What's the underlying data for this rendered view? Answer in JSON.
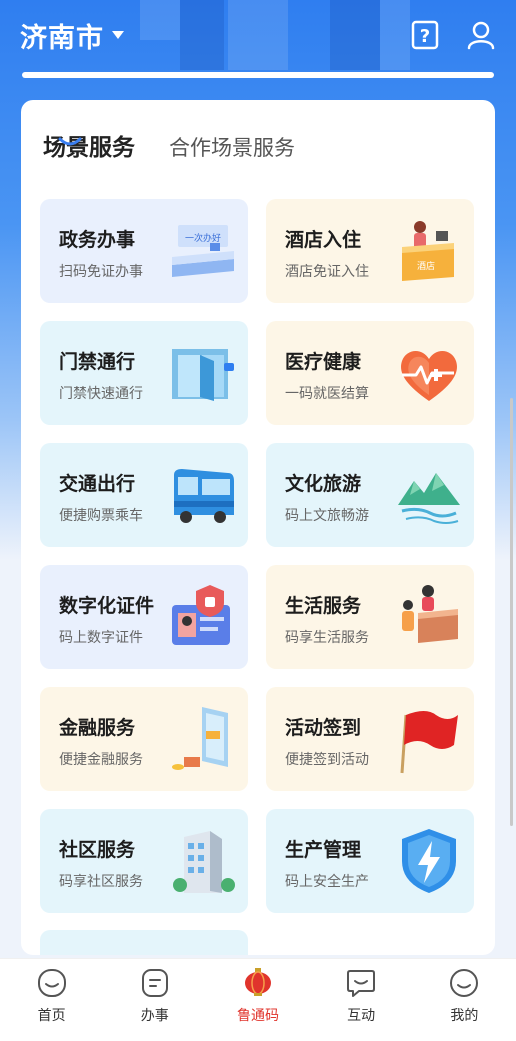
{
  "header": {
    "city": "济南市",
    "icons": [
      "help-icon",
      "user-icon"
    ]
  },
  "tabs": [
    {
      "label": "场景服务",
      "active": true
    },
    {
      "label": "合作场景服务",
      "active": false
    }
  ],
  "cards": [
    {
      "title": "政务办事",
      "subtitle": "扫码免证办事",
      "icon": "service-counter-icon",
      "tone": "blue",
      "art_text": "一次办好"
    },
    {
      "title": "酒店入住",
      "subtitle": "酒店免证入住",
      "icon": "hotel-reception-icon",
      "tone": "cream",
      "art_text": "酒店"
    },
    {
      "title": "门禁通行",
      "subtitle": "门禁快速通行",
      "icon": "door-access-icon",
      "tone": "cyan"
    },
    {
      "title": "医疗健康",
      "subtitle": "一码就医结算",
      "icon": "heart-health-icon",
      "tone": "cream"
    },
    {
      "title": "交通出行",
      "subtitle": "便捷购票乘车",
      "icon": "bus-icon",
      "tone": "cyan"
    },
    {
      "title": "文化旅游",
      "subtitle": "码上文旅畅游",
      "icon": "mountain-icon",
      "tone": "cyan"
    },
    {
      "title": "数字化证件",
      "subtitle": "码上数字证件",
      "icon": "id-card-icon",
      "tone": "blue"
    },
    {
      "title": "生活服务",
      "subtitle": "码享生活服务",
      "icon": "life-service-icon",
      "tone": "cream"
    },
    {
      "title": "金融服务",
      "subtitle": "便捷金融服务",
      "icon": "finance-icon",
      "tone": "cream"
    },
    {
      "title": "活动签到",
      "subtitle": "便捷签到活动",
      "icon": "flag-icon",
      "tone": "cream"
    },
    {
      "title": "社区服务",
      "subtitle": "码享社区服务",
      "icon": "building-icon",
      "tone": "cyan"
    },
    {
      "title": "生产管理",
      "subtitle": "码上安全生产",
      "icon": "shield-bolt-icon",
      "tone": "cyan"
    }
  ],
  "bottom_nav": [
    {
      "label": "首页",
      "icon": "home-icon",
      "active": false
    },
    {
      "label": "办事",
      "icon": "tasks-icon",
      "active": false
    },
    {
      "label": "鲁通码",
      "icon": "lantern-icon",
      "active": true
    },
    {
      "label": "互动",
      "icon": "chat-icon",
      "active": false
    },
    {
      "label": "我的",
      "icon": "profile-icon",
      "active": false
    }
  ],
  "colors": {
    "accent_active": "#e0342c",
    "header_blue": "#2f7ef0",
    "tab_indicator": "#3a7ef0"
  }
}
